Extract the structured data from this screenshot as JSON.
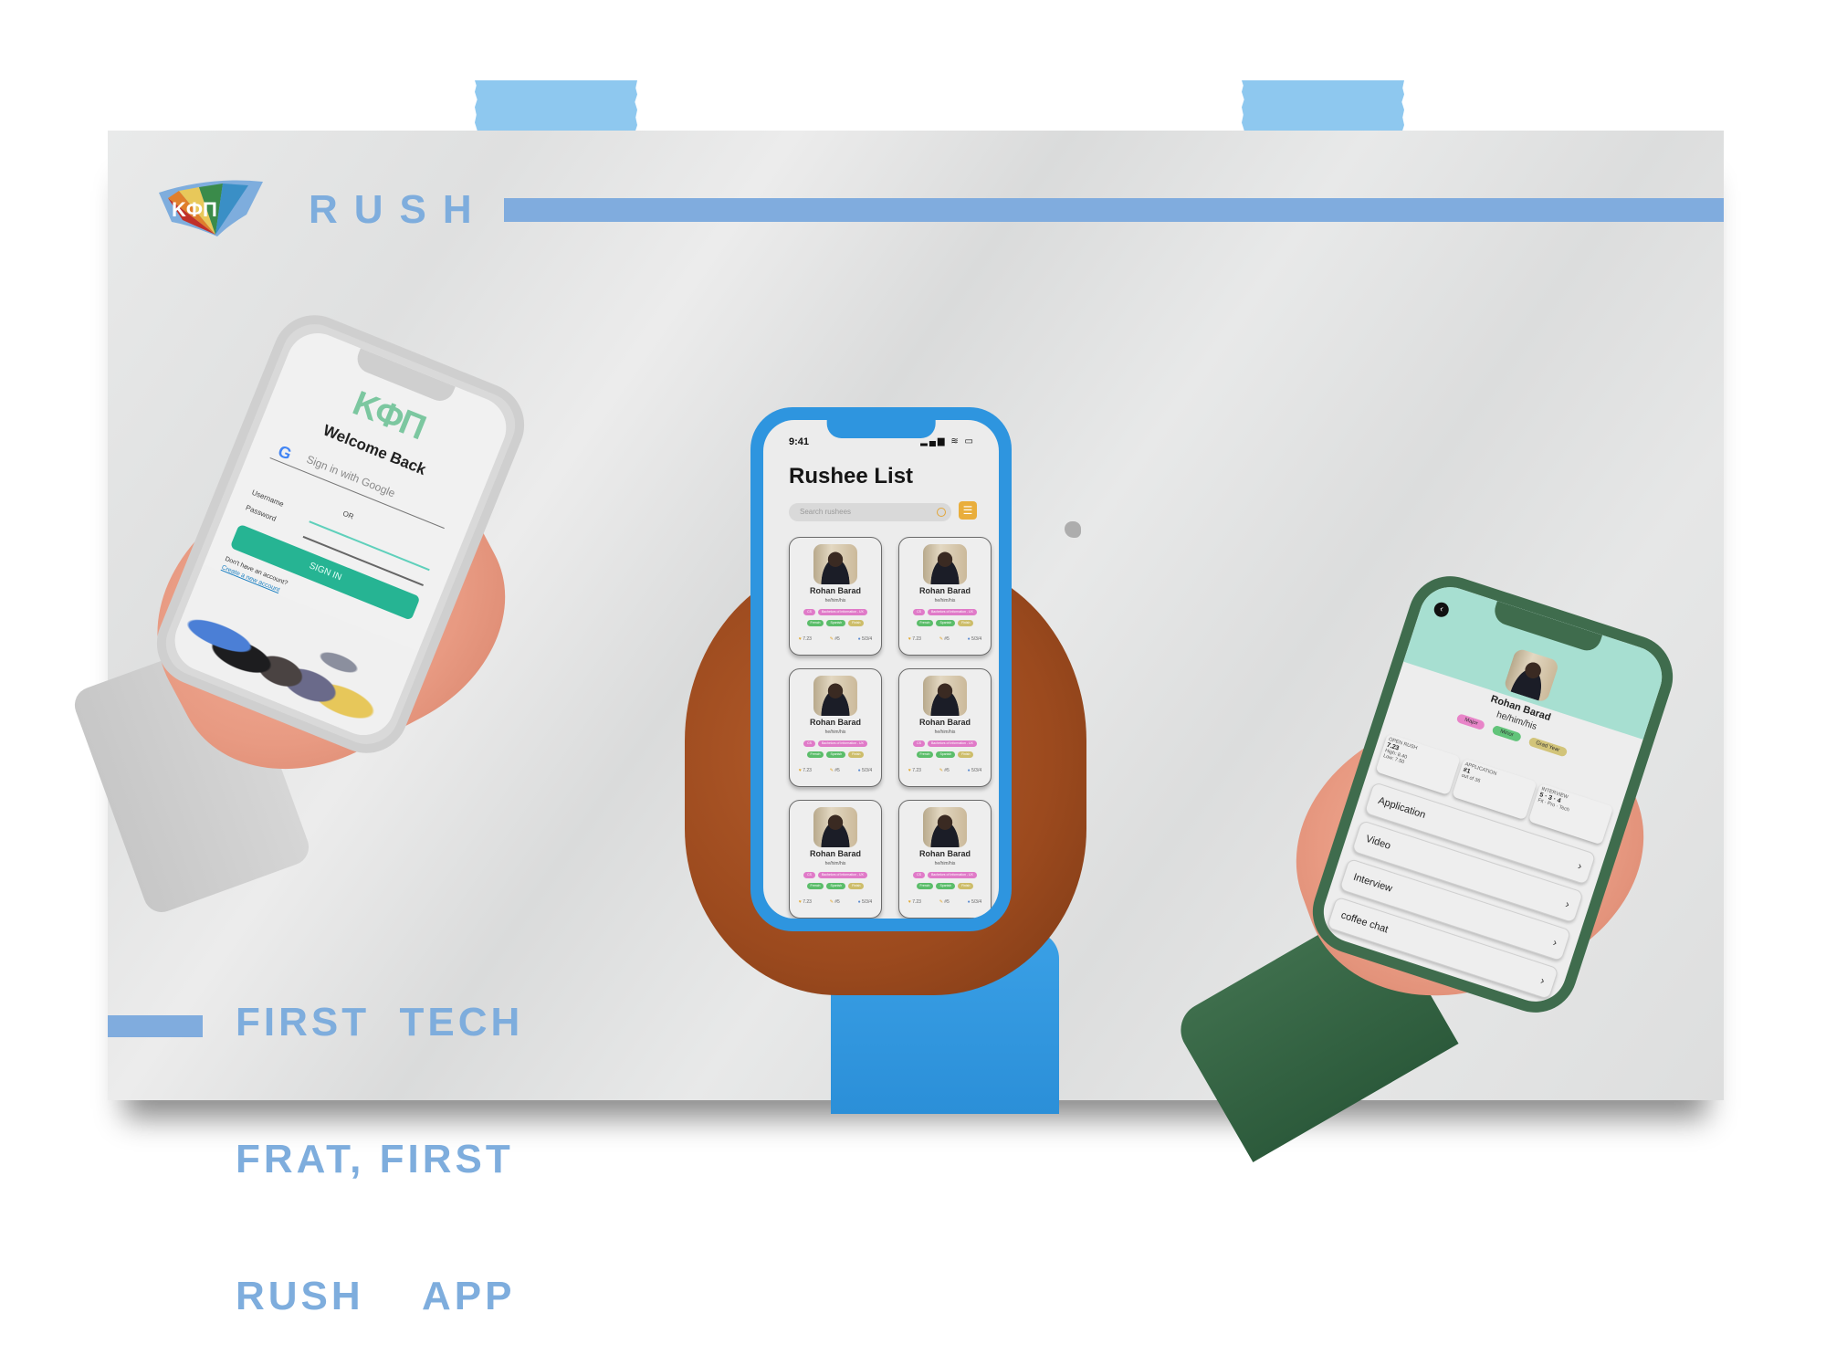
{
  "brand": {
    "logo_text": "KΦΠ",
    "logo_colors": [
      "#c0302a",
      "#e07f2c",
      "#e8c85a",
      "#3a8b4a",
      "#3a8fc6"
    ],
    "title": "RUSH",
    "accent_color": "#7eaddd",
    "tape_color": "#8ec8ef"
  },
  "tagline": {
    "lines": [
      "FIRST  TECH",
      "FRAT, FIRST",
      "RUSH    APP"
    ]
  },
  "phone_login": {
    "logo": "KΦΠ",
    "welcome": "Welcome Back",
    "google_label": "Sign in with Google",
    "google_icon": "google-g-icon",
    "or_label": "OR",
    "username_label": "Username",
    "password_label": "Password",
    "signin_label": "SIGN IN",
    "no_account_text": "Don't have an account?",
    "create_account_link": "Create a new account",
    "button_color": "#26b493"
  },
  "phone_list": {
    "status_time": "9:41",
    "status_icons": "▂▄▆ ≋ ▭",
    "title": "Rushee List",
    "search_placeholder": "Search rushees",
    "filter_icon": "☰",
    "cards": [
      {
        "name": "Rohan Barad",
        "pronouns": "he/him/his",
        "tags_row1": [
          "CS",
          "Bachelors of Information - UX"
        ],
        "tags_row2": [
          "French",
          "Spanish",
          "Finish"
        ],
        "stat_score": "7.23",
        "stat_rank": "#5",
        "stat_date": "5/3/4"
      },
      {
        "name": "Rohan Barad",
        "pronouns": "he/him/his",
        "tags_row1": [
          "CS",
          "Bachelors of Information - UX"
        ],
        "tags_row2": [
          "French",
          "Spanish",
          "Finish"
        ],
        "stat_score": "7.23",
        "stat_rank": "#5",
        "stat_date": "5/3/4"
      },
      {
        "name": "Rohan Barad",
        "pronouns": "he/him/his",
        "tags_row1": [
          "CS",
          "Bachelors of Information - UX"
        ],
        "tags_row2": [
          "French",
          "Spanish",
          "Finish"
        ],
        "stat_score": "7.23",
        "stat_rank": "#5",
        "stat_date": "5/3/4"
      },
      {
        "name": "Rohan Barad",
        "pronouns": "he/him/his",
        "tags_row1": [
          "CS",
          "Bachelors of Information - UX"
        ],
        "tags_row2": [
          "French",
          "Spanish",
          "Finish"
        ],
        "stat_score": "7.23",
        "stat_rank": "#5",
        "stat_date": "5/3/4"
      },
      {
        "name": "Rohan Barad",
        "pronouns": "he/him/his",
        "tags_row1": [
          "CS",
          "Bachelors of Information - UX"
        ],
        "tags_row2": [
          "French",
          "Spanish",
          "Finish"
        ],
        "stat_score": "7.23",
        "stat_rank": "#5",
        "stat_date": "5/3/4"
      },
      {
        "name": "Rohan Barad",
        "pronouns": "he/him/his",
        "tags_row1": [
          "CS",
          "Bachelors of Information - UX"
        ],
        "tags_row2": [
          "French",
          "Spanish",
          "Finish"
        ],
        "stat_score": "7.23",
        "stat_rank": "#5",
        "stat_date": "5/3/4"
      }
    ],
    "tag_colors": {
      "pink": "#e07ac8",
      "green": "#5bbd6a",
      "gold": "#cdbd6a"
    },
    "frame_color": "#2e95df"
  },
  "phone_profile": {
    "back_icon": "‹",
    "name": "Rohan Barad",
    "pronouns": "he/him/his",
    "tags": [
      {
        "label": "Major",
        "color": "#e884c8"
      },
      {
        "label": "Minor",
        "color": "#62c47a"
      },
      {
        "label": "Grad Year",
        "color": "#d2c479"
      }
    ],
    "stats": [
      {
        "title": "OPEN RUSH",
        "value": "7.23",
        "sub1": "High: 8.40",
        "sub2": "Low: 7.50"
      },
      {
        "title": "APPLICATION",
        "value": "#1",
        "sub1": "out of 36",
        "sub2": ""
      },
      {
        "title": "INTERVIEW",
        "value": "5 · 3 · 4",
        "sub1": "Fit · Pro · Tech",
        "sub2": ""
      }
    ],
    "sections": [
      {
        "label": "Application",
        "chevron": "›"
      },
      {
        "label": "Video",
        "chevron": "›"
      },
      {
        "label": "Interview",
        "chevron": "›"
      },
      {
        "label": "coffee chat",
        "chevron": "›"
      }
    ],
    "frame_color": "#3f6c4d",
    "header_color": "#a7dfd1"
  }
}
